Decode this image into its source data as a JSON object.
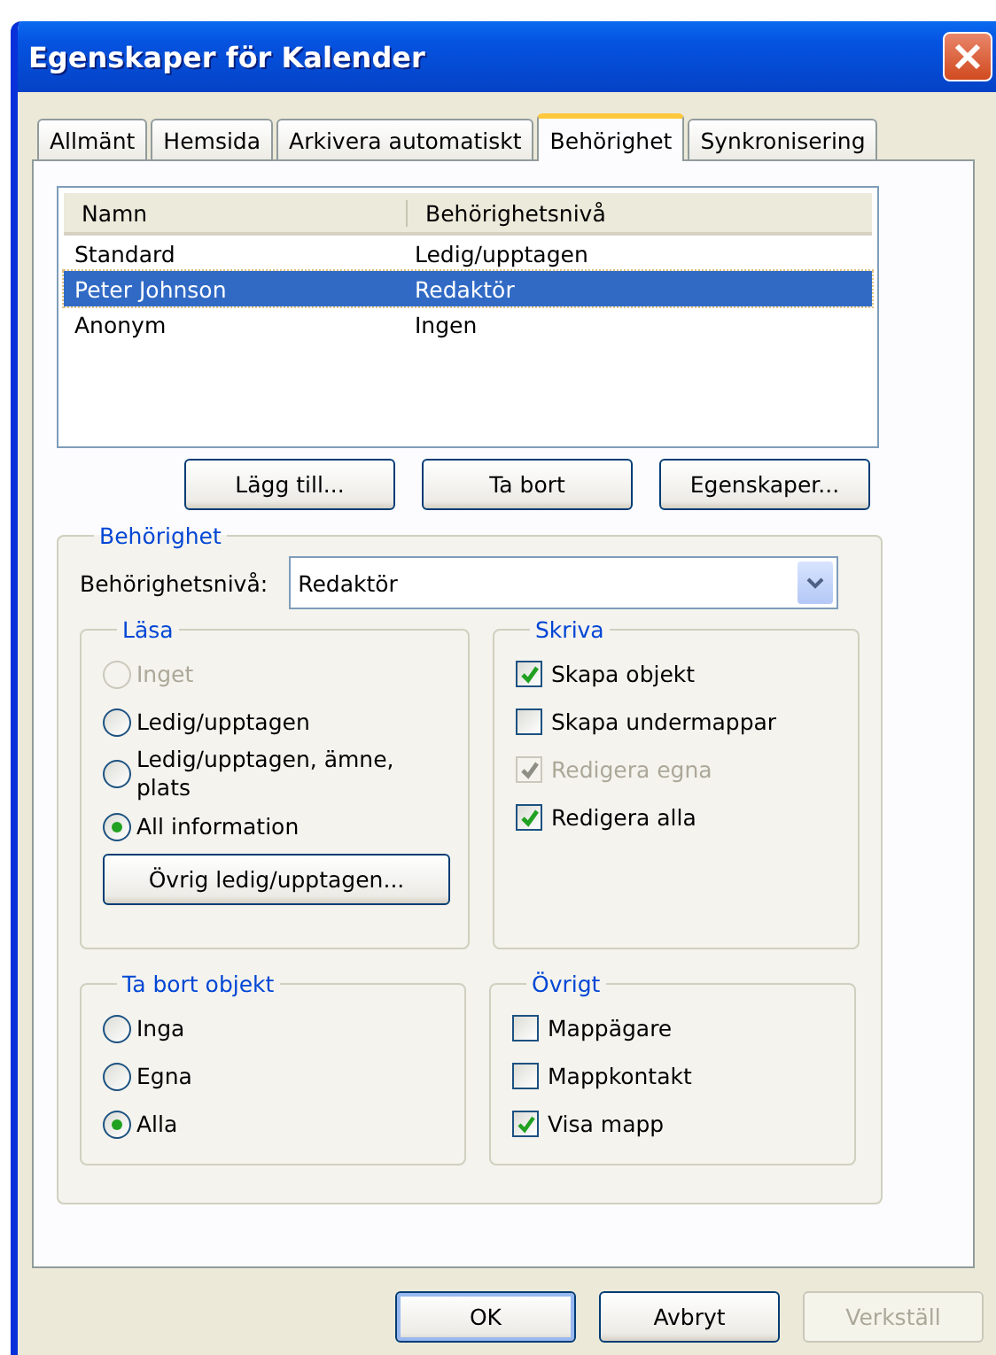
{
  "window": {
    "title": "Egenskaper för Kalender"
  },
  "tabs": [
    {
      "label": "Allmänt",
      "selected": false
    },
    {
      "label": "Hemsida",
      "selected": false
    },
    {
      "label": "Arkivera automatiskt",
      "selected": false
    },
    {
      "label": "Behörighet",
      "selected": true
    },
    {
      "label": "Synkronisering",
      "selected": false
    }
  ],
  "permissions_table": {
    "columns": [
      "Namn",
      "Behörighetsnivå"
    ],
    "rows": [
      {
        "name": "Standard",
        "level": "Ledig/upptagen",
        "selected": false
      },
      {
        "name": "Peter Johnson",
        "level": "Redaktör",
        "selected": true
      },
      {
        "name": "Anonym",
        "level": "Ingen",
        "selected": false
      }
    ]
  },
  "list_buttons": [
    "Lägg till...",
    "Ta bort",
    "Egenskaper..."
  ],
  "permissions_group": {
    "title": "Behörighet",
    "level_label": "Behörighetsnivå:",
    "level_value": "Redaktör",
    "read": {
      "title": "Läsa",
      "options": [
        {
          "label": "Inget",
          "selected": false,
          "disabled": true
        },
        {
          "label": "Ledig/upptagen",
          "selected": false,
          "disabled": false
        },
        {
          "label": "Ledig/upptagen, ämne, plats",
          "selected": false,
          "disabled": false
        },
        {
          "label": "All information",
          "selected": true,
          "disabled": false
        }
      ],
      "button": "Övrig ledig/upptagen..."
    },
    "write": {
      "title": "Skriva",
      "options": [
        {
          "label": "Skapa objekt",
          "checked": true,
          "disabled": false
        },
        {
          "label": "Skapa undermappar",
          "checked": false,
          "disabled": false
        },
        {
          "label": "Redigera egna",
          "checked": true,
          "disabled": true
        },
        {
          "label": "Redigera alla",
          "checked": true,
          "disabled": false
        }
      ]
    },
    "delete": {
      "title": "Ta bort objekt",
      "options": [
        {
          "label": "Inga",
          "selected": false,
          "disabled": false
        },
        {
          "label": "Egna",
          "selected": false,
          "disabled": false
        },
        {
          "label": "Alla",
          "selected": true,
          "disabled": false
        }
      ]
    },
    "other": {
      "title": "Övrigt",
      "options": [
        {
          "label": "Mappägare",
          "checked": false,
          "disabled": false
        },
        {
          "label": "Mappkontakt",
          "checked": false,
          "disabled": false
        },
        {
          "label": "Visa mapp",
          "checked": true,
          "disabled": false
        }
      ]
    }
  },
  "dialog_buttons": [
    {
      "label": "OK",
      "default": true,
      "disabled": false
    },
    {
      "label": "Avbryt",
      "default": false,
      "disabled": false
    },
    {
      "label": "Verkställ",
      "default": false,
      "disabled": true
    }
  ]
}
